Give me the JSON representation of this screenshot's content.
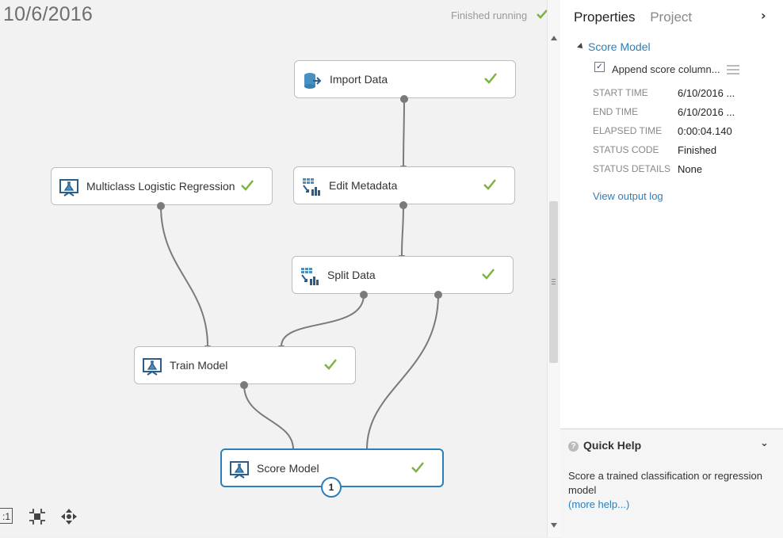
{
  "experiment": {
    "title": "10/6/2016",
    "status_text": "Finished running"
  },
  "nodes": {
    "import_data": "Import Data",
    "edit_metadata": "Edit Metadata",
    "multiclass_lr": "Multiclass Logistic Regression",
    "split_data": "Split Data",
    "train_model": "Train Model",
    "score_model": "Score Model",
    "score_model_badge": "1"
  },
  "panel": {
    "tabs": [
      "Properties",
      "Project"
    ],
    "module_title": "Score Model",
    "checkbox_label": "Append score column...",
    "checkbox_mark": "✓",
    "props": [
      {
        "key": "START TIME",
        "value": "6/10/2016 ..."
      },
      {
        "key": "END TIME",
        "value": "6/10/2016 ..."
      },
      {
        "key": "ELAPSED TIME",
        "value": "0:00:04.140"
      },
      {
        "key": "STATUS CODE",
        "value": "Finished"
      },
      {
        "key": "STATUS DETAILS",
        "value": "None"
      }
    ],
    "output_log": "View output log"
  },
  "quick_help": {
    "title": "Quick Help",
    "text": "Score a trained classification or regression model",
    "link": "(more help...)"
  },
  "toolbar": {
    "fit_label": ":1"
  },
  "colors": {
    "accent": "#2c7fb8",
    "check": "#7cb342",
    "wire": "#7a7a7a"
  }
}
